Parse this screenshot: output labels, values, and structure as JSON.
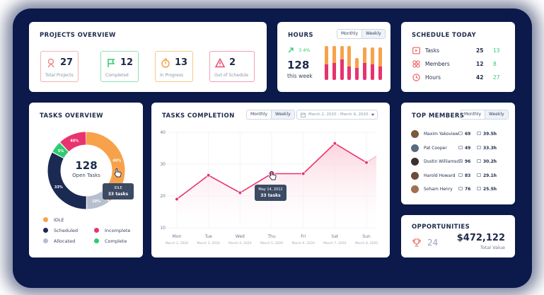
{
  "projects": {
    "title": "PROJECTS OVERVIEW",
    "stats": [
      {
        "value": "27",
        "label": "Total Projects",
        "icon": "rocket-icon",
        "color": "#f08b8b"
      },
      {
        "value": "12",
        "label": "Completed",
        "icon": "flag-icon",
        "color": "#2ecc71"
      },
      {
        "value": "13",
        "label": "In Progress",
        "icon": "timer-icon",
        "color": "#f5a142"
      },
      {
        "value": "2",
        "label": "Out of Schedule",
        "icon": "warning-icon",
        "color": "#e84a6f"
      }
    ]
  },
  "hours": {
    "title": "HOURS",
    "toggle": [
      "Monthly",
      "Weekly"
    ],
    "change": "3.4%",
    "total": "128",
    "total_label": "this week",
    "bars": [
      {
        "orange": 0.55,
        "pink": 0.45
      },
      {
        "orange": 0.5,
        "pink": 0.5
      },
      {
        "orange": 0.4,
        "pink": 0.6
      },
      {
        "orange": 0.6,
        "pink": 0.4
      },
      {
        "orange": 0.3,
        "pink": 0.35
      },
      {
        "orange": 0.45,
        "pink": 0.5
      },
      {
        "orange": 0.5,
        "pink": 0.45
      },
      {
        "orange": 0.55,
        "pink": 0.4
      }
    ]
  },
  "schedule": {
    "title": "SCHEDULE TODAY",
    "rows": [
      {
        "label": "Tasks",
        "value": "25",
        "extra": "13",
        "icon": "play-icon"
      },
      {
        "label": "Members",
        "value": "12",
        "extra": "8",
        "icon": "members-icon"
      },
      {
        "label": "Hours",
        "value": "42",
        "extra": "27",
        "icon": "clock-icon"
      }
    ]
  },
  "tasks_overview": {
    "title": "TASKS OVERVIEW",
    "center_value": "128",
    "center_label": "Open Tasks",
    "segments": [
      {
        "name": "IDLE",
        "pct": 40,
        "label": "40%",
        "color": "#f7a24b"
      },
      {
        "name": "Allocated",
        "pct": 10,
        "label": "10%",
        "color": "#b6bfcf"
      },
      {
        "name": "Scheduled",
        "pct": 33,
        "label": "33%",
        "color": "#1b2a52"
      },
      {
        "name": "Complete",
        "pct": 5,
        "label": "5%",
        "color": "#2ecc71"
      },
      {
        "name": "Incomplete",
        "pct": 12,
        "label": "40%",
        "color": "#e8336e"
      }
    ],
    "tooltip": {
      "title": "IDLE",
      "value": "33 tasks"
    },
    "legend": [
      {
        "label": "IDLE",
        "color": "#f7a24b"
      },
      {
        "label": "Scheduled",
        "color": "#1b2a52"
      },
      {
        "label": "Incomplete",
        "color": "#e8336e"
      },
      {
        "label": "Allocated",
        "color": "#b6bfcf"
      },
      {
        "label": "Complete",
        "color": "#2ecc71"
      }
    ]
  },
  "tasks_completion": {
    "title": "TASKS COMPLETION",
    "toggle": [
      "Monthly",
      "Weekly"
    ],
    "date_range": "March 2, 2020 - March 9, 2020",
    "tooltip": {
      "date": "May 14, 2012",
      "value": "33 tasks"
    }
  },
  "chart_data": {
    "type": "area",
    "title": "TASKS COMPLETION",
    "x": [
      "Mon",
      "Tue",
      "Wed",
      "Thu",
      "Fri",
      "Sat",
      "Sun"
    ],
    "x_dates": [
      "March 2, 2020",
      "March 3, 2020",
      "March 4, 2020",
      "March 5, 2020",
      "March 6, 2020",
      "March 7, 2020",
      "March 8, 2020"
    ],
    "series": [
      {
        "values": [
          19,
          26.5,
          21,
          27,
          27,
          36.5,
          30.5
        ]
      }
    ],
    "trailing_value": 32.5,
    "yticks": [
      10,
      20,
      30,
      40
    ],
    "ylim": [
      10,
      40
    ],
    "grid": true,
    "colors": {
      "line": "#e8336e",
      "fill": "#fbd3de"
    }
  },
  "top_members": {
    "title": "TOP MEMBERS",
    "toggle": [
      "Monthly",
      "Weekly"
    ],
    "rows": [
      {
        "name": "Maxim Yakoview",
        "tasks": "69",
        "hours": "39.5h"
      },
      {
        "name": "Pat Cooper",
        "tasks": "49",
        "hours": "33.3h"
      },
      {
        "name": "Dustin Williamson",
        "tasks": "96",
        "hours": "30.2h"
      },
      {
        "name": "Harold Howard",
        "tasks": "83",
        "hours": "29.1h"
      },
      {
        "name": "Soham Henry",
        "tasks": "76",
        "hours": "25.5h"
      }
    ]
  },
  "opportunities": {
    "title": "OPPORTUNITIES",
    "count": "24",
    "total": "$472,122",
    "total_label": "Total Value"
  }
}
